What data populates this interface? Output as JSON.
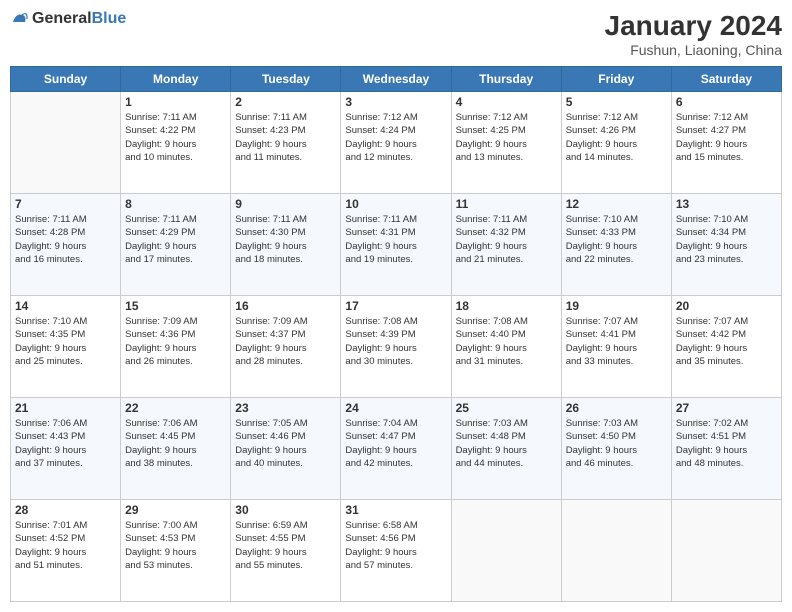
{
  "logo": {
    "general": "General",
    "blue": "Blue"
  },
  "header": {
    "title": "January 2024",
    "subtitle": "Fushun, Liaoning, China"
  },
  "days": [
    "Sunday",
    "Monday",
    "Tuesday",
    "Wednesday",
    "Thursday",
    "Friday",
    "Saturday"
  ],
  "weeks": [
    [
      {
        "day": "",
        "info": ""
      },
      {
        "day": "1",
        "info": "Sunrise: 7:11 AM\nSunset: 4:22 PM\nDaylight: 9 hours\nand 10 minutes."
      },
      {
        "day": "2",
        "info": "Sunrise: 7:11 AM\nSunset: 4:23 PM\nDaylight: 9 hours\nand 11 minutes."
      },
      {
        "day": "3",
        "info": "Sunrise: 7:12 AM\nSunset: 4:24 PM\nDaylight: 9 hours\nand 12 minutes."
      },
      {
        "day": "4",
        "info": "Sunrise: 7:12 AM\nSunset: 4:25 PM\nDaylight: 9 hours\nand 13 minutes."
      },
      {
        "day": "5",
        "info": "Sunrise: 7:12 AM\nSunset: 4:26 PM\nDaylight: 9 hours\nand 14 minutes."
      },
      {
        "day": "6",
        "info": "Sunrise: 7:12 AM\nSunset: 4:27 PM\nDaylight: 9 hours\nand 15 minutes."
      }
    ],
    [
      {
        "day": "7",
        "info": "Sunrise: 7:11 AM\nSunset: 4:28 PM\nDaylight: 9 hours\nand 16 minutes."
      },
      {
        "day": "8",
        "info": "Sunrise: 7:11 AM\nSunset: 4:29 PM\nDaylight: 9 hours\nand 17 minutes."
      },
      {
        "day": "9",
        "info": "Sunrise: 7:11 AM\nSunset: 4:30 PM\nDaylight: 9 hours\nand 18 minutes."
      },
      {
        "day": "10",
        "info": "Sunrise: 7:11 AM\nSunset: 4:31 PM\nDaylight: 9 hours\nand 19 minutes."
      },
      {
        "day": "11",
        "info": "Sunrise: 7:11 AM\nSunset: 4:32 PM\nDaylight: 9 hours\nand 21 minutes."
      },
      {
        "day": "12",
        "info": "Sunrise: 7:10 AM\nSunset: 4:33 PM\nDaylight: 9 hours\nand 22 minutes."
      },
      {
        "day": "13",
        "info": "Sunrise: 7:10 AM\nSunset: 4:34 PM\nDaylight: 9 hours\nand 23 minutes."
      }
    ],
    [
      {
        "day": "14",
        "info": "Sunrise: 7:10 AM\nSunset: 4:35 PM\nDaylight: 9 hours\nand 25 minutes."
      },
      {
        "day": "15",
        "info": "Sunrise: 7:09 AM\nSunset: 4:36 PM\nDaylight: 9 hours\nand 26 minutes."
      },
      {
        "day": "16",
        "info": "Sunrise: 7:09 AM\nSunset: 4:37 PM\nDaylight: 9 hours\nand 28 minutes."
      },
      {
        "day": "17",
        "info": "Sunrise: 7:08 AM\nSunset: 4:39 PM\nDaylight: 9 hours\nand 30 minutes."
      },
      {
        "day": "18",
        "info": "Sunrise: 7:08 AM\nSunset: 4:40 PM\nDaylight: 9 hours\nand 31 minutes."
      },
      {
        "day": "19",
        "info": "Sunrise: 7:07 AM\nSunset: 4:41 PM\nDaylight: 9 hours\nand 33 minutes."
      },
      {
        "day": "20",
        "info": "Sunrise: 7:07 AM\nSunset: 4:42 PM\nDaylight: 9 hours\nand 35 minutes."
      }
    ],
    [
      {
        "day": "21",
        "info": "Sunrise: 7:06 AM\nSunset: 4:43 PM\nDaylight: 9 hours\nand 37 minutes."
      },
      {
        "day": "22",
        "info": "Sunrise: 7:06 AM\nSunset: 4:45 PM\nDaylight: 9 hours\nand 38 minutes."
      },
      {
        "day": "23",
        "info": "Sunrise: 7:05 AM\nSunset: 4:46 PM\nDaylight: 9 hours\nand 40 minutes."
      },
      {
        "day": "24",
        "info": "Sunrise: 7:04 AM\nSunset: 4:47 PM\nDaylight: 9 hours\nand 42 minutes."
      },
      {
        "day": "25",
        "info": "Sunrise: 7:03 AM\nSunset: 4:48 PM\nDaylight: 9 hours\nand 44 minutes."
      },
      {
        "day": "26",
        "info": "Sunrise: 7:03 AM\nSunset: 4:50 PM\nDaylight: 9 hours\nand 46 minutes."
      },
      {
        "day": "27",
        "info": "Sunrise: 7:02 AM\nSunset: 4:51 PM\nDaylight: 9 hours\nand 48 minutes."
      }
    ],
    [
      {
        "day": "28",
        "info": "Sunrise: 7:01 AM\nSunset: 4:52 PM\nDaylight: 9 hours\nand 51 minutes."
      },
      {
        "day": "29",
        "info": "Sunrise: 7:00 AM\nSunset: 4:53 PM\nDaylight: 9 hours\nand 53 minutes."
      },
      {
        "day": "30",
        "info": "Sunrise: 6:59 AM\nSunset: 4:55 PM\nDaylight: 9 hours\nand 55 minutes."
      },
      {
        "day": "31",
        "info": "Sunrise: 6:58 AM\nSunset: 4:56 PM\nDaylight: 9 hours\nand 57 minutes."
      },
      {
        "day": "",
        "info": ""
      },
      {
        "day": "",
        "info": ""
      },
      {
        "day": "",
        "info": ""
      }
    ]
  ]
}
